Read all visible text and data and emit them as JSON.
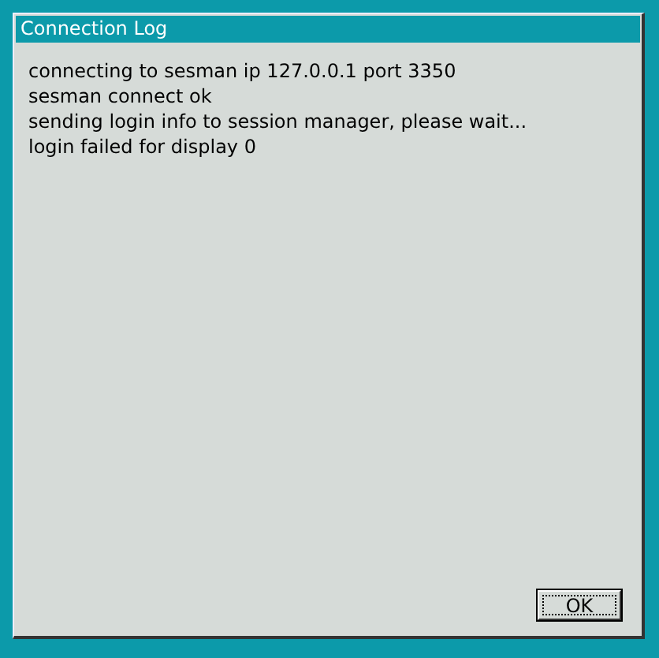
{
  "window": {
    "title": "Connection Log"
  },
  "log_lines": [
    "connecting to sesman ip 127.0.0.1 port 3350",
    "sesman connect ok",
    "sending login info to session manager, please wait...",
    "login failed for display 0"
  ],
  "buttons": [
    {
      "label": "OK",
      "focused": true
    }
  ]
}
